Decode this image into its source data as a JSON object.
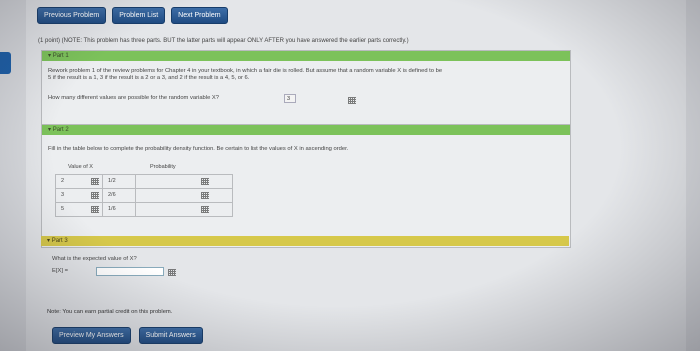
{
  "nav": {
    "previous": "Previous Problem",
    "list": "Problem List",
    "next": "Next Problem"
  },
  "intro_note": "(1 point) (NOTE: This problem has three parts. BUT the latter parts will appear ONLY AFTER you have answered the earlier parts correctly.)",
  "part1": {
    "title": "Part 1",
    "text_line1": "Rework problem 1 of the review problems for Chapter 4 in your textbook, in which a fair die is rolled. But assume that a random variable X is defined to be",
    "text_line2": "5 if the result is a 1, 3 if the result is a 2 or a 3, and 2 if the result is a 4, 5, or 6.",
    "question": "How many different values are possible for the random variable X?",
    "answer": "3"
  },
  "part2": {
    "title": "Part 2",
    "instruction": "Fill in the table below to complete the probability density function. Be certain to list the values of X in ascending order.",
    "col_value": "Value of X",
    "col_prob": "Probability",
    "rows": [
      {
        "value": "2",
        "prob": "1/2"
      },
      {
        "value": "3",
        "prob": "2/6"
      },
      {
        "value": "5",
        "prob": "1/6"
      }
    ]
  },
  "part3": {
    "title": "Part 3",
    "question": "What is the expected value of X?",
    "label": "E[X] ="
  },
  "footer_note": "Note: You can earn partial credit on this problem.",
  "actions": {
    "preview": "Preview My Answers",
    "submit": "Submit Answers"
  }
}
